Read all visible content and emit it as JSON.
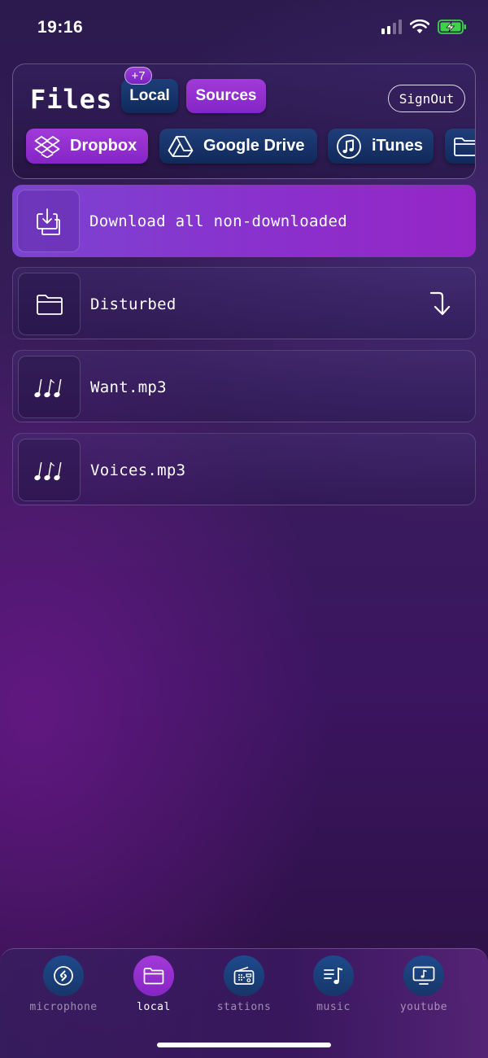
{
  "status_bar": {
    "time": "19:16",
    "icons": [
      "cellular-signal-icon",
      "wifi-icon",
      "battery-charging-icon"
    ]
  },
  "header": {
    "title": "Files",
    "tabs": [
      {
        "label": "Local",
        "badge": "+7",
        "active": false
      },
      {
        "label": "Sources",
        "active": true
      }
    ],
    "signout_label": "SignOut"
  },
  "sources": [
    {
      "label": "Dropbox",
      "icon": "dropbox-icon",
      "active": true
    },
    {
      "label": "Google Drive",
      "icon": "google-drive-icon",
      "active": false
    },
    {
      "label": "iTunes",
      "icon": "itunes-icon",
      "active": false
    },
    {
      "label": "",
      "icon": "folder-icon",
      "active": false
    }
  ],
  "list": [
    {
      "label": "Download all non-downloaded",
      "icon": "download-icon",
      "highlight": true
    },
    {
      "label": "Disturbed",
      "icon": "folder-icon",
      "action_icon": "arrow-down-icon"
    },
    {
      "label": "Want.mp3",
      "icon": "music-notes-icon"
    },
    {
      "label": "Voices.mp3",
      "icon": "music-notes-icon"
    }
  ],
  "bottom_nav": [
    {
      "label": "microphone",
      "icon": "shazam-icon",
      "active": false
    },
    {
      "label": "local",
      "icon": "folder-icon",
      "active": true
    },
    {
      "label": "stations",
      "icon": "radio-icon",
      "active": false
    },
    {
      "label": "music",
      "icon": "music-list-icon",
      "active": false
    },
    {
      "label": "youtube",
      "icon": "tv-icon",
      "active": false
    }
  ],
  "colors": {
    "accent_purple": "#9a34d4",
    "accent_blue": "#183a72",
    "battery_green": "#3fd14a"
  }
}
